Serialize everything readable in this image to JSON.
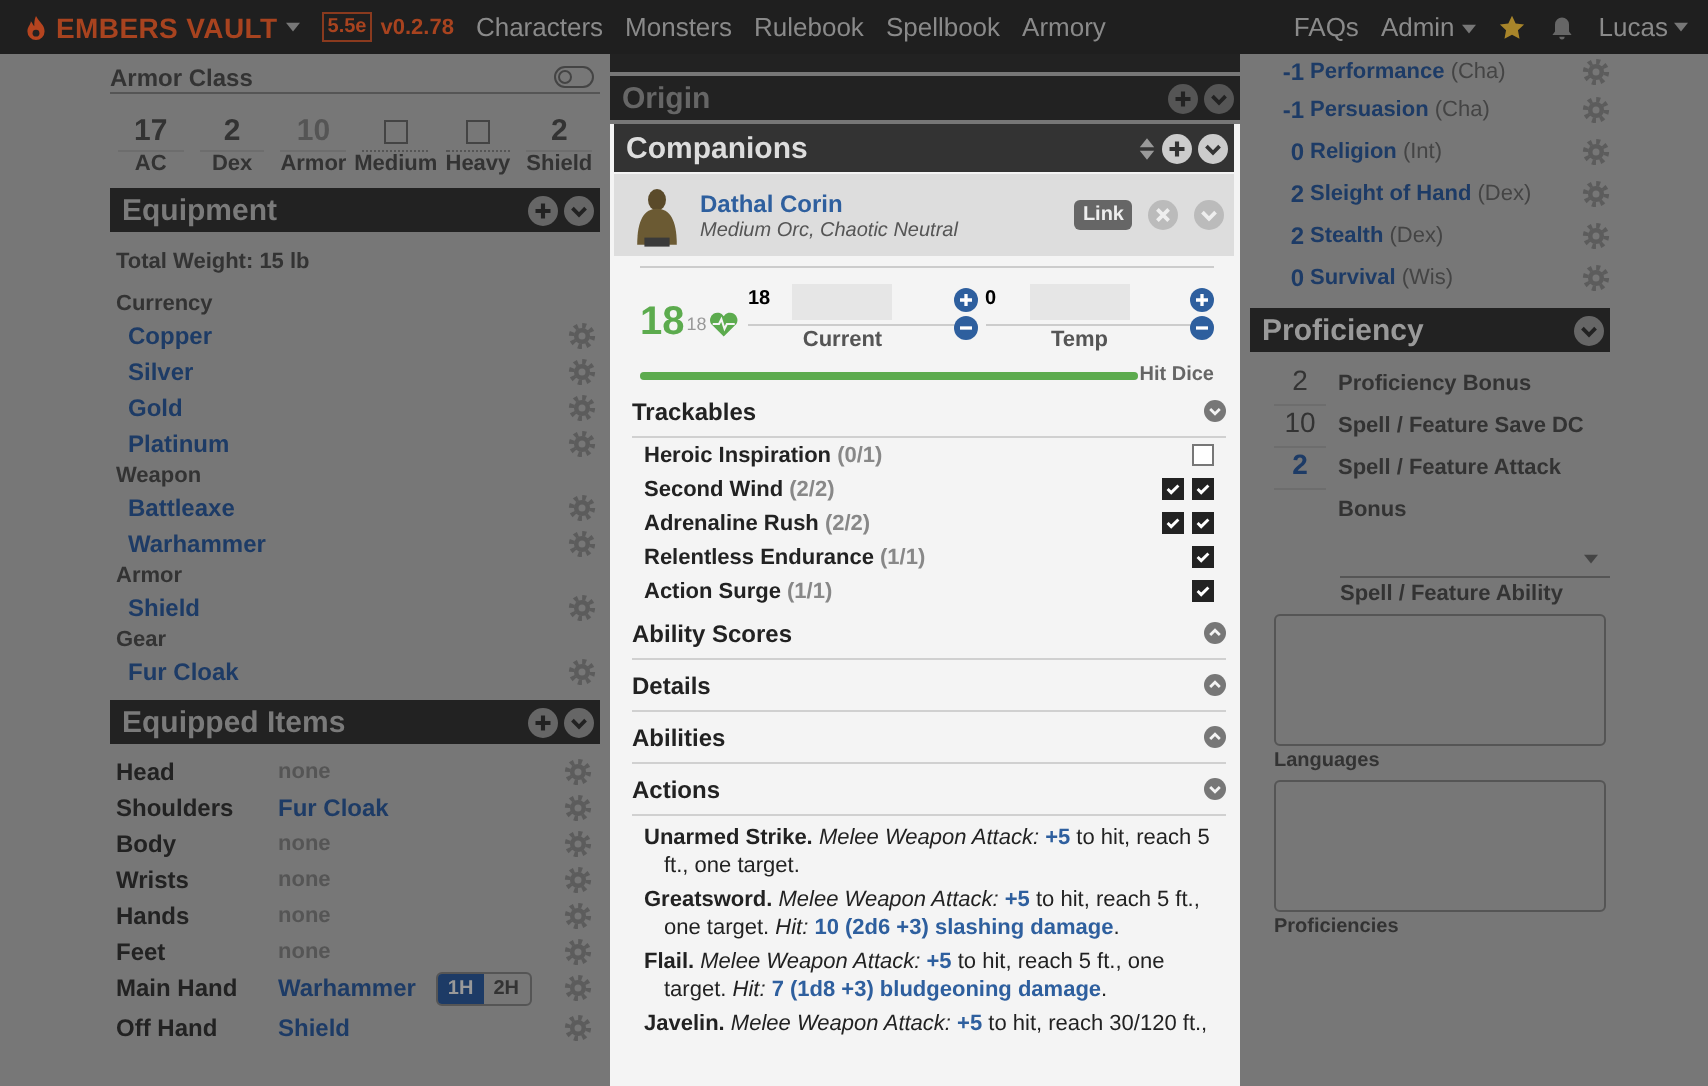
{
  "nav": {
    "brand": "EMBERS VAULT",
    "edition": "5.5e",
    "version": "v0.2.78",
    "links": [
      "Characters",
      "Monsters",
      "Rulebook",
      "Spellbook",
      "Armory"
    ],
    "right_links": [
      {
        "label": "FAQs",
        "dropdown": false
      },
      {
        "label": "Admin",
        "dropdown": true
      }
    ],
    "user": "Lucas"
  },
  "left": {
    "armor_class": {
      "title": "Armor Class",
      "toggle_on": false,
      "stats": [
        {
          "kind": "number",
          "value": "17",
          "label": "AC",
          "muted": false
        },
        {
          "kind": "number",
          "value": "2",
          "label": "Dex",
          "muted": false
        },
        {
          "kind": "number",
          "value": "10",
          "label": "Armor",
          "muted": true
        },
        {
          "kind": "checkbox",
          "checked": false,
          "label": "Medium"
        },
        {
          "kind": "checkbox",
          "checked": false,
          "label": "Heavy"
        },
        {
          "kind": "number",
          "value": "2",
          "label": "Shield",
          "muted": false
        }
      ]
    },
    "equipment": {
      "title": "Equipment",
      "total_weight": "Total Weight: 15 lb",
      "groups": [
        {
          "name": "Currency",
          "items": [
            "Copper",
            "Silver",
            "Gold",
            "Platinum"
          ]
        },
        {
          "name": "Weapon",
          "items": [
            "Battleaxe",
            "Warhammer"
          ]
        },
        {
          "name": "Armor",
          "items": [
            "Shield"
          ]
        },
        {
          "name": "Gear",
          "items": [
            "Fur Cloak"
          ]
        }
      ]
    },
    "equipped_items": {
      "title": "Equipped Items",
      "slots": [
        {
          "slot": "Head",
          "item": "none",
          "empty": true
        },
        {
          "slot": "Shoulders",
          "item": "Fur Cloak",
          "empty": false
        },
        {
          "slot": "Body",
          "item": "none",
          "empty": true
        },
        {
          "slot": "Wrists",
          "item": "none",
          "empty": true
        },
        {
          "slot": "Hands",
          "item": "none",
          "empty": true
        },
        {
          "slot": "Feet",
          "item": "none",
          "empty": true
        },
        {
          "slot": "Main Hand",
          "item": "Warhammer",
          "empty": false,
          "grip": [
            {
              "label": "1H",
              "selected": true
            },
            {
              "label": "2H",
              "selected": false
            }
          ]
        },
        {
          "slot": "Off Hand",
          "item": "Shield",
          "empty": false
        }
      ]
    }
  },
  "middle": {
    "origin": {
      "title": "Origin"
    },
    "companions": {
      "title": "Companions"
    },
    "companion": {
      "name": "Dathal Corin",
      "description": "Medium Orc, Chaotic Neutral",
      "link_label": "Link",
      "hp": {
        "value": "18",
        "max": "18",
        "current": "18",
        "current_label": "Current",
        "temp": "0",
        "temp_label": "Temp",
        "level": 1,
        "hit_dice_label": "Hit Dice"
      },
      "trackables": {
        "title": "Trackables",
        "expanded": true,
        "items": [
          {
            "name": "Heroic Inspiration",
            "count": "(0/1)",
            "uses": [
              {
                "checked": false
              }
            ]
          },
          {
            "name": "Second Wind",
            "count": "(2/2)",
            "uses": [
              {
                "checked": true
              },
              {
                "checked": true
              }
            ]
          },
          {
            "name": "Adrenaline Rush",
            "count": "(2/2)",
            "uses": [
              {
                "checked": true
              },
              {
                "checked": true
              }
            ]
          },
          {
            "name": "Relentless Endurance",
            "count": "(1/1)",
            "uses": [
              {
                "checked": true
              }
            ]
          },
          {
            "name": "Action Surge",
            "count": "(1/1)",
            "uses": [
              {
                "checked": true
              }
            ]
          }
        ]
      },
      "sections": [
        {
          "title": "Ability Scores",
          "expanded": false
        },
        {
          "title": "Details",
          "expanded": false
        },
        {
          "title": "Abilities",
          "expanded": false
        },
        {
          "title": "Actions",
          "expanded": true
        }
      ],
      "actions": [
        {
          "name": "Unarmed Strike.",
          "attack": "Melee Weapon Attack:",
          "bonus": "+5",
          "reach": "to hit, reach 5 ft., one target."
        },
        {
          "name": "Greatsword.",
          "attack": "Melee Weapon Attack:",
          "bonus": "+5",
          "reach": "to hit, reach 5 ft., one target.",
          "hit_label": "Hit:",
          "damage": "10 (2d6 +3) slashing damage",
          "end": "."
        },
        {
          "name": "Flail.",
          "attack": "Melee Weapon Attack:",
          "bonus": "+5",
          "reach": "to hit, reach 5 ft., one target.",
          "hit_label": "Hit:",
          "damage": "7 (1d8 +3) bludgeoning damage",
          "end": "."
        },
        {
          "name": "Javelin.",
          "attack": "Melee Weapon Attack:",
          "bonus": "+5",
          "reach": "to hit, reach 30/120 ft.,"
        }
      ]
    }
  },
  "right": {
    "skills": [
      {
        "modifier": "-1",
        "name": "Performance",
        "ability": "(Cha)"
      },
      {
        "modifier": "-1",
        "name": "Persuasion",
        "ability": "(Cha)"
      },
      {
        "modifier": "0",
        "name": "Religion",
        "ability": "(Int)"
      },
      {
        "modifier": "2",
        "name": "Sleight of Hand",
        "ability": "(Dex)"
      },
      {
        "modifier": "2",
        "name": "Stealth",
        "ability": "(Dex)"
      },
      {
        "modifier": "0",
        "name": "Survival",
        "ability": "(Wis)"
      }
    ],
    "proficiency": {
      "title": "Proficiency",
      "rows": [
        {
          "value": "2",
          "label": "Proficiency Bonus",
          "highlight": false
        },
        {
          "value": "10",
          "label": "Spell / Feature Save DC",
          "highlight": false
        },
        {
          "value": "2",
          "label": "Spell / Feature Attack Bonus",
          "highlight": true
        }
      ],
      "ability_label": "Spell / Feature Ability",
      "textareas": [
        "Languages",
        "Proficiencies"
      ]
    }
  }
}
